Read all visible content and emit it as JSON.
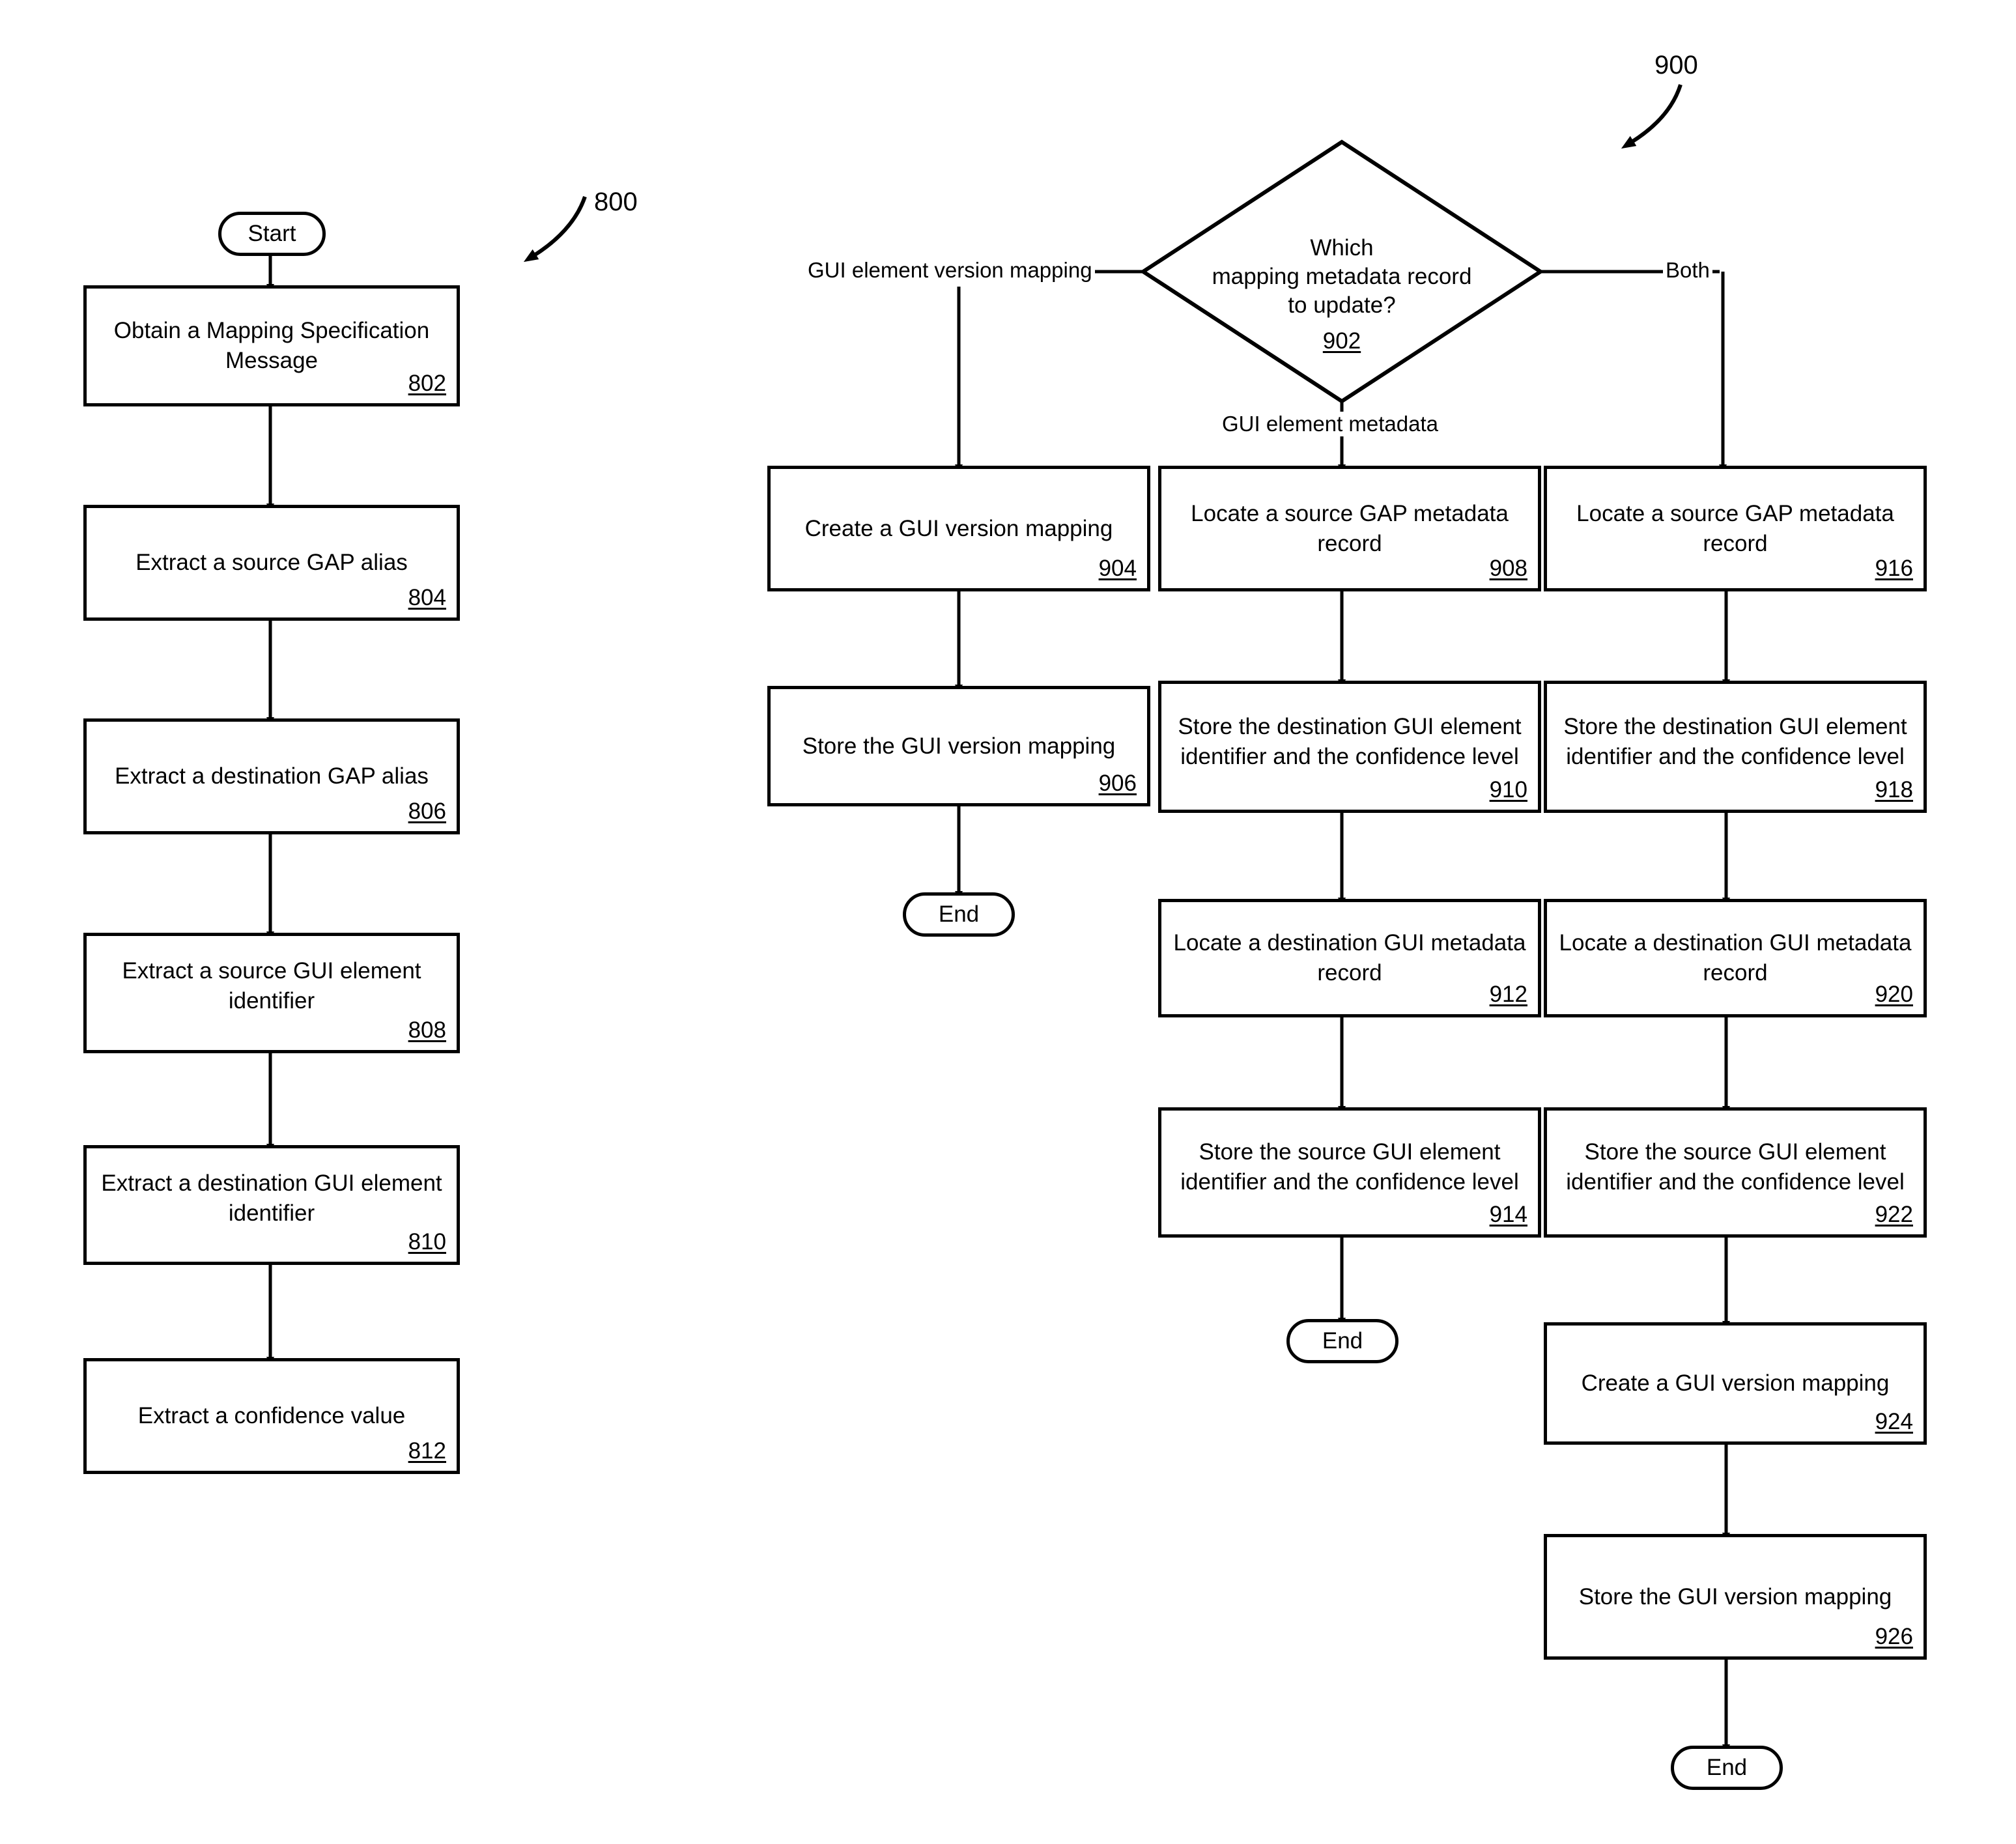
{
  "figures": [
    {
      "id": "fig-800",
      "label": "800"
    },
    {
      "id": "fig-900",
      "label": "900"
    }
  ],
  "flow_800": {
    "figure_number": "800",
    "start_label": "Start",
    "steps": [
      {
        "ref": "802",
        "text": "Obtain a Mapping Specification Message"
      },
      {
        "ref": "804",
        "text": "Extract a source GAP alias"
      },
      {
        "ref": "806",
        "text": "Extract a destination GAP alias"
      },
      {
        "ref": "808",
        "text": "Extract a source GUI element identifier"
      },
      {
        "ref": "810",
        "text": "Extract a destination GUI element identifier"
      },
      {
        "ref": "812",
        "text": "Extract a confidence value"
      }
    ]
  },
  "flow_900": {
    "figure_number": "900",
    "decision": {
      "ref": "902",
      "line1": "Which",
      "line2": "mapping metadata record",
      "line3": "to update?"
    },
    "edge_labels": {
      "left": "GUI element version mapping",
      "center": "GUI element metadata",
      "right": "Both"
    },
    "branch_left": [
      {
        "ref": "904",
        "text": "Create a GUI version mapping"
      },
      {
        "ref": "906",
        "text": "Store the GUI version mapping"
      }
    ],
    "branch_center": [
      {
        "ref": "908",
        "text": "Locate a source GAP metadata record"
      },
      {
        "ref": "910",
        "text": "Store the destination GUI element identifier and the confidence level"
      },
      {
        "ref": "912",
        "text": "Locate a destination GUI metadata record"
      },
      {
        "ref": "914",
        "text": "Store the source GUI element identifier and the confidence level"
      }
    ],
    "branch_right": [
      {
        "ref": "916",
        "text": "Locate a source GAP metadata record"
      },
      {
        "ref": "918",
        "text": "Store the destination GUI element identifier and the confidence level"
      },
      {
        "ref": "920",
        "text": "Locate a destination GUI metadata record"
      },
      {
        "ref": "922",
        "text": "Store the source GUI element identifier and the confidence level"
      },
      {
        "ref": "924",
        "text": "Create a GUI version mapping"
      },
      {
        "ref": "926",
        "text": "Store the GUI version mapping"
      }
    ],
    "end_labels": {
      "left": "End",
      "center": "End",
      "right": "End"
    }
  }
}
